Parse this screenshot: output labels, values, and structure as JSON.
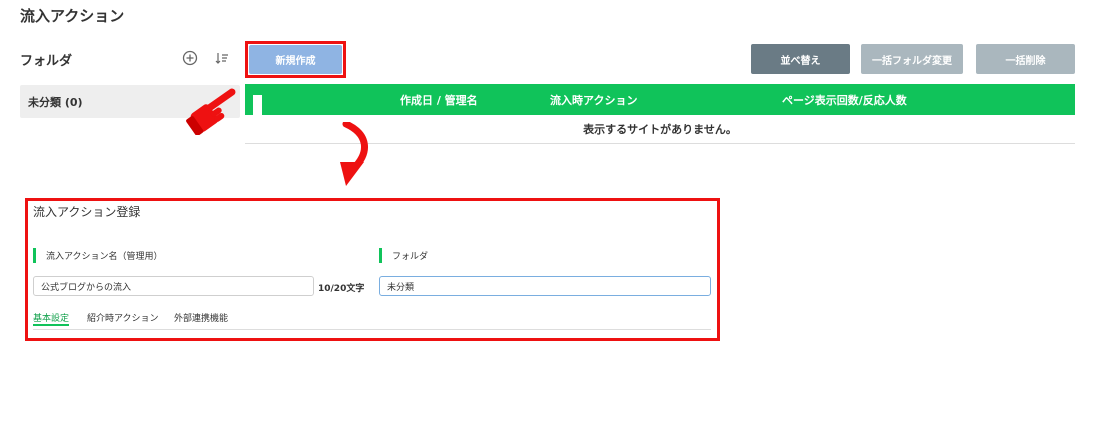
{
  "page": {
    "title": "流入アクション"
  },
  "sidebar": {
    "heading": "フォルダ",
    "items": [
      {
        "label": "未分類 (0)"
      }
    ],
    "add_icon": "plus-circle-icon",
    "sort_icon": "sort-icon"
  },
  "toolbar": {
    "new_label": "新規作成",
    "sort_label": "並べ替え",
    "bulk_folder_label": "一括フォルダ変更",
    "bulk_delete_label": "一括削除"
  },
  "table": {
    "columns": [
      "作成日 / 管理名",
      "流入時アクション",
      "ページ表示回数/反応人数"
    ],
    "empty_message": "表示するサイトがありません。"
  },
  "form": {
    "title": "流入アクション登録",
    "name_label": "流入アクション名（管理用）",
    "name_value": "公式ブログからの流入",
    "name_counter": "10/20文字",
    "folder_label": "フォルダ",
    "folder_value": "未分類",
    "tabs": [
      {
        "label": "基本設定",
        "active": true
      },
      {
        "label": "紹介時アクション",
        "active": false
      },
      {
        "label": "外部連携機能",
        "active": false
      }
    ]
  },
  "colors": {
    "accent_green": "#10c35a",
    "highlight_red": "#ee1111",
    "new_button_blue": "#8fb4e3"
  },
  "annotations": {
    "pointer_icon": "pointing-hand-icon",
    "arrow_icon": "curved-arrow-icon"
  }
}
